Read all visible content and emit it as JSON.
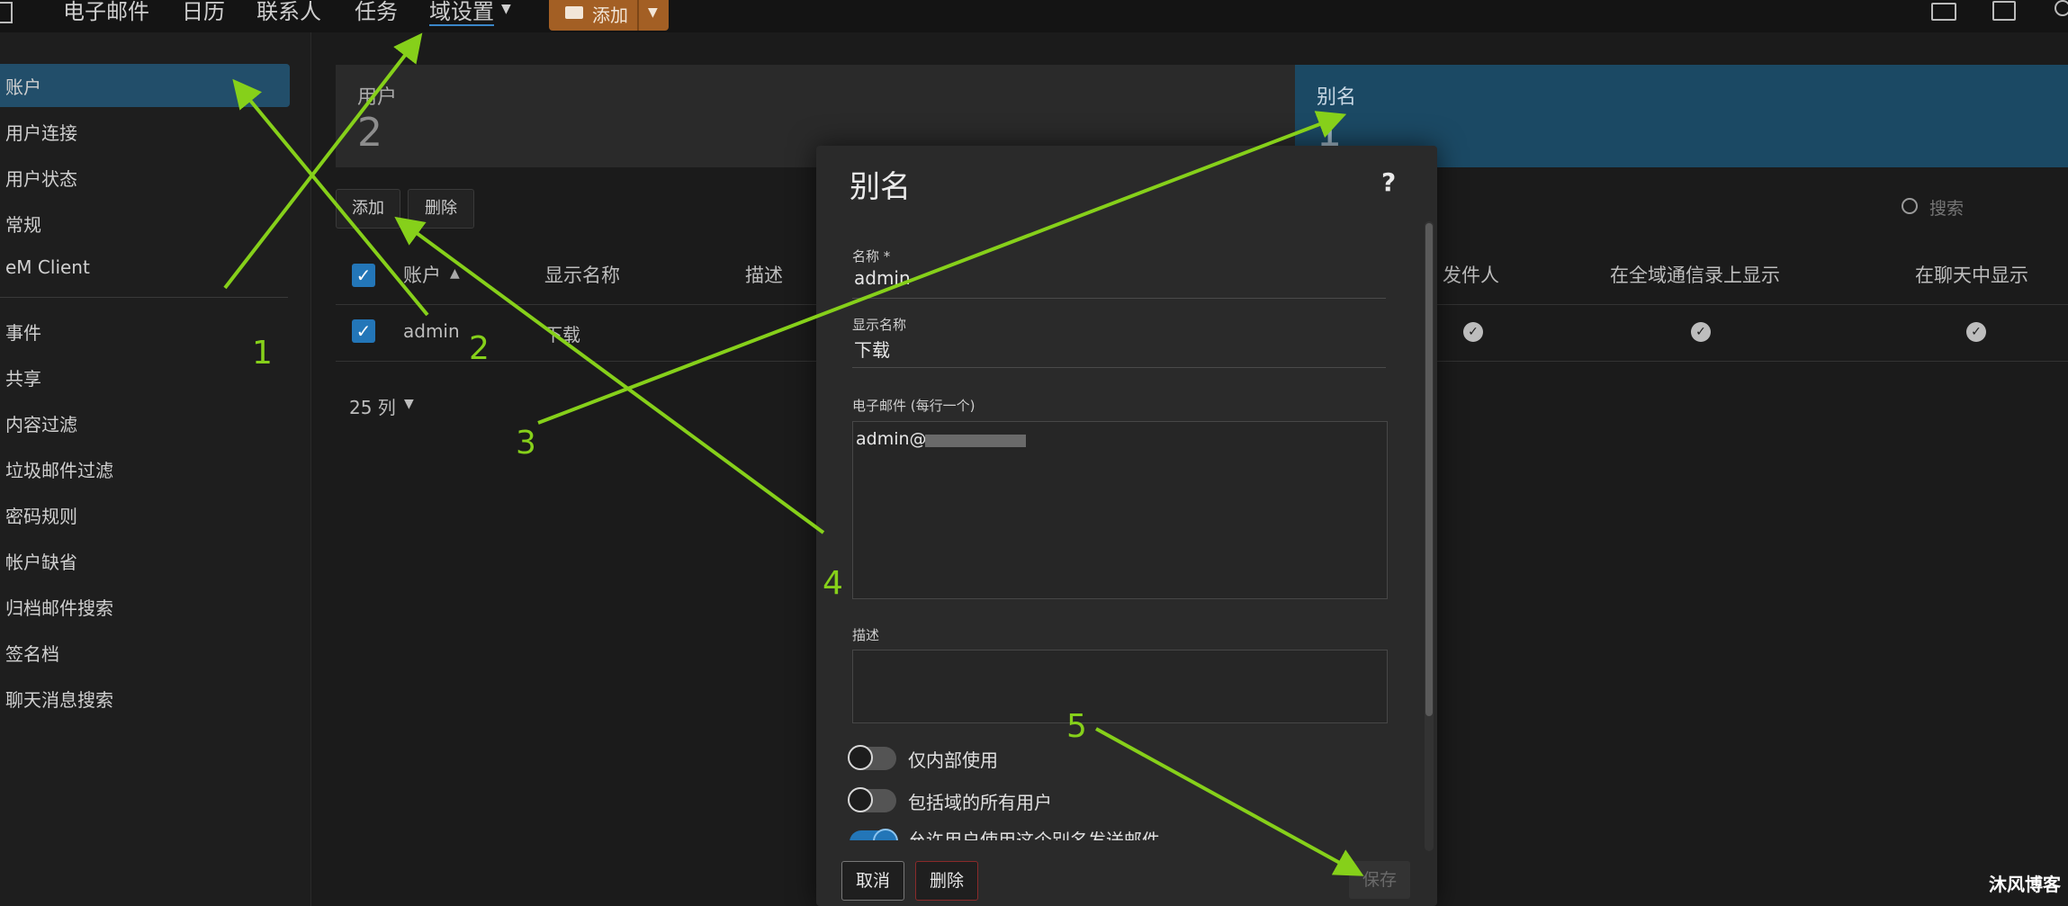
{
  "topnav": {
    "items": [
      "电子邮件",
      "日历",
      "联系人",
      "任务",
      "域设置"
    ],
    "add_label": "添加"
  },
  "sidebar": {
    "group1": [
      "账户",
      "用户连接",
      "用户状态",
      "常规",
      "eM Client"
    ],
    "group2": [
      "事件",
      "共享",
      "内容过滤",
      "垃圾邮件过滤",
      "密码规则",
      "帐户缺省",
      "归档邮件搜索",
      "签名档",
      "聊天消息搜索"
    ]
  },
  "cards": {
    "users": {
      "label": "用户",
      "value": "2"
    },
    "aliases": {
      "label": "别名",
      "value": "1"
    }
  },
  "toolbar": {
    "add": "添加",
    "delete": "删除",
    "search_placeholder": "搜索"
  },
  "table": {
    "headers": [
      "账户",
      "显示名称",
      "描述",
      "发件人",
      "在全域通信录上显示",
      "在聊天中显示"
    ],
    "row": {
      "account": "admin",
      "display_name": "下载"
    },
    "page_size": "25 列"
  },
  "dialog": {
    "title": "别名",
    "help": "?",
    "name_label": "名称 *",
    "name_value": "admin",
    "display_label": "显示名称",
    "display_value": "下载",
    "emails_label": "电子邮件 (每行一个)",
    "emails_value": "admin@",
    "desc_label": "描述",
    "toggles": [
      "仅内部使用",
      "包括域的所有用户",
      "允许用户使用这个别名发送邮件"
    ],
    "cancel": "取消",
    "delete": "删除",
    "save": "保存"
  },
  "annotations": [
    "1",
    "2",
    "3",
    "4",
    "5"
  ],
  "watermark": "沐风博客",
  "colors": {
    "arrow": "#86d01a",
    "accent": "#224e6a",
    "add_button": "#a35f24"
  }
}
